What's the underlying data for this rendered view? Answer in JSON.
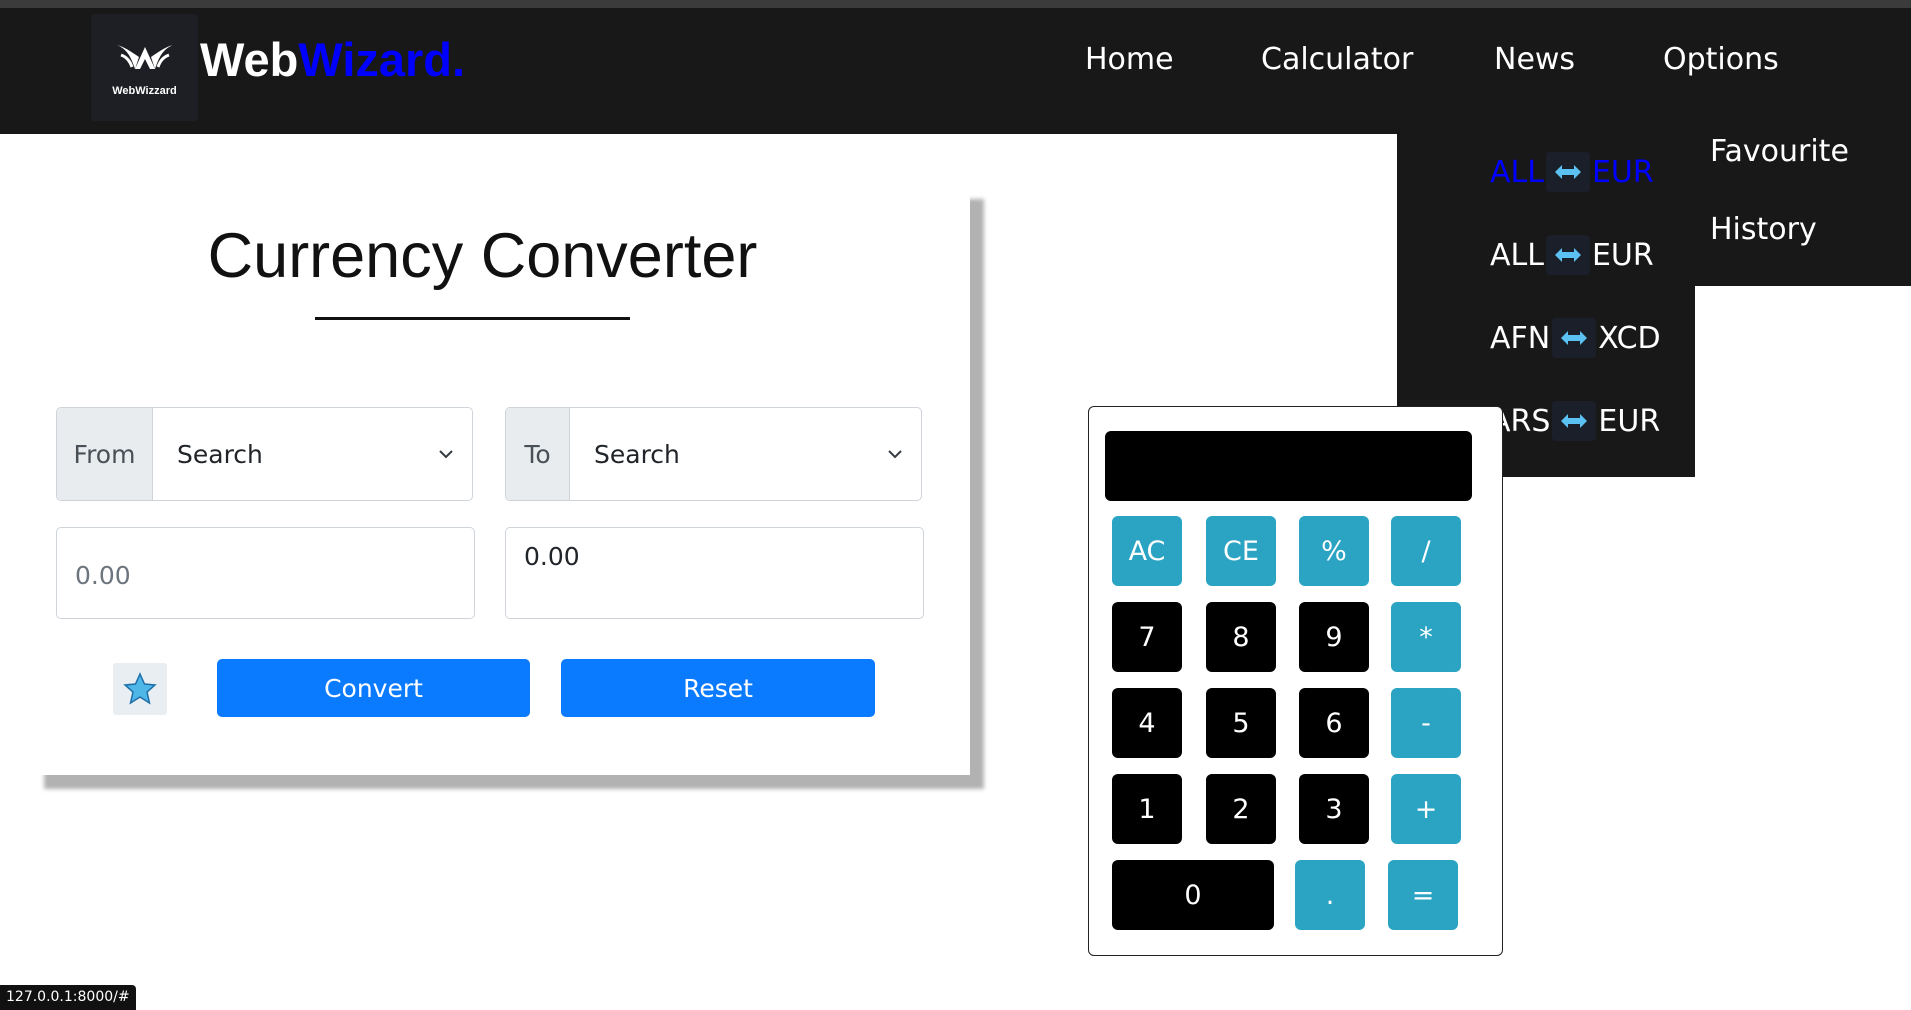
{
  "brand": {
    "name_part1": "Web",
    "name_part2": "Wizard.",
    "logo_caption": "WebWizzard"
  },
  "nav": {
    "items": [
      "Home",
      "Calculator",
      "News",
      "Options"
    ]
  },
  "news_dropdown": {
    "pairs": [
      {
        "from": "ALL",
        "to": "EUR",
        "active": true
      },
      {
        "from": "ALL",
        "to": "EUR",
        "active": false
      },
      {
        "from": "AFN",
        "to": "XCD",
        "active": false
      },
      {
        "from": "ARS",
        "to": "EUR",
        "active": false
      }
    ]
  },
  "options_dropdown": {
    "items": [
      "Favourite",
      "History"
    ]
  },
  "converter": {
    "title": "Currency Converter",
    "from_label": "From",
    "from_value": "Search",
    "to_label": "To",
    "to_value": "Search",
    "amount_placeholder": "0.00",
    "result_value": "0.00",
    "convert_label": "Convert",
    "reset_label": "Reset",
    "favorite_icon": "star-icon"
  },
  "calculator": {
    "display": "",
    "keys": [
      {
        "label": "AC",
        "kind": "op"
      },
      {
        "label": "CE",
        "kind": "op"
      },
      {
        "label": "%",
        "kind": "op"
      },
      {
        "label": "/",
        "kind": "op"
      },
      {
        "label": "7",
        "kind": "num"
      },
      {
        "label": "8",
        "kind": "num"
      },
      {
        "label": "9",
        "kind": "num"
      },
      {
        "label": "*",
        "kind": "op"
      },
      {
        "label": "4",
        "kind": "num"
      },
      {
        "label": "5",
        "kind": "num"
      },
      {
        "label": "6",
        "kind": "num"
      },
      {
        "label": "-",
        "kind": "op"
      },
      {
        "label": "1",
        "kind": "num"
      },
      {
        "label": "2",
        "kind": "num"
      },
      {
        "label": "3",
        "kind": "num"
      },
      {
        "label": "+",
        "kind": "op"
      },
      {
        "label": "0",
        "kind": "num"
      },
      {
        "label": ".",
        "kind": "op"
      },
      {
        "label": "=",
        "kind": "op"
      }
    ]
  },
  "status_bar": {
    "url": "127.0.0.1:8000/#"
  },
  "colors": {
    "navbar": "#181818",
    "brand_accent": "#0000ff",
    "button_primary": "#0a7bff",
    "calc_operator": "#2ba3c3",
    "calc_number": "#000000"
  }
}
